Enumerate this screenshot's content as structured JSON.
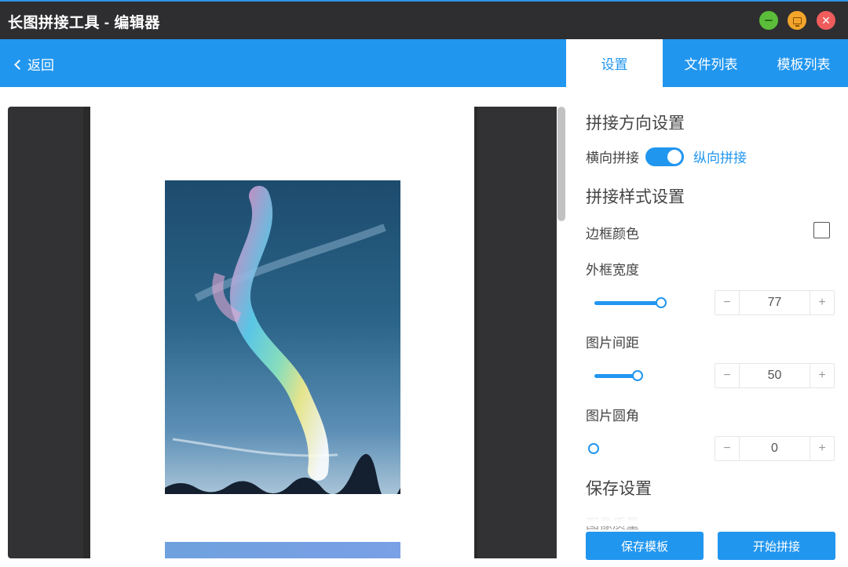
{
  "window": {
    "title": "长图拼接工具 - 编辑器"
  },
  "header": {
    "back_label": "返回",
    "tabs": [
      {
        "label": "设置",
        "active": true
      },
      {
        "label": "文件列表",
        "active": false
      },
      {
        "label": "模板列表",
        "active": false
      }
    ]
  },
  "settings": {
    "direction": {
      "title": "拼接方向设置",
      "horizontal_label": "横向拼接",
      "vertical_label": "纵向拼接",
      "selected": "纵向拼接"
    },
    "style": {
      "title": "拼接样式设置",
      "border_color_label": "边框颜色",
      "border_color_checked": false,
      "outer_border_width": {
        "label": "外框宽度",
        "value": "77",
        "minus": "−",
        "plus": "+"
      },
      "image_spacing": {
        "label": "图片间距",
        "value": "50",
        "minus": "−",
        "plus": "+"
      },
      "image_radius": {
        "label": "图片圆角",
        "value": "0",
        "minus": "−",
        "plus": "+"
      }
    },
    "save": {
      "title": "保存设置",
      "image_quality_label": "图像质量"
    },
    "buttons": {
      "save_template": "保存模板",
      "start_stitch": "开始拼接"
    }
  },
  "colors": {
    "accent": "#2196ef",
    "titlebar": "#2e2e30",
    "preview_bg": "#323234",
    "minimize": "#5bbd3a",
    "maximize": "#f2a52a",
    "close": "#ef5c5c"
  },
  "icons": {
    "back": "chevron-left-icon",
    "minimize": "minimize-icon",
    "maximize": "maximize-icon",
    "close": "close-icon"
  }
}
